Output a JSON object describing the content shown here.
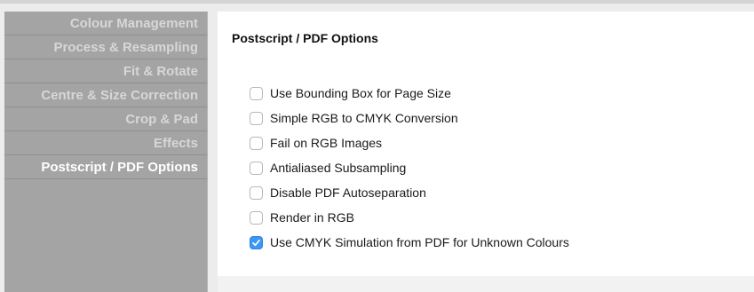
{
  "sidebar": {
    "items": [
      {
        "label": "Colour Management",
        "active": false
      },
      {
        "label": "Process & Resampling",
        "active": false
      },
      {
        "label": "Fit & Rotate",
        "active": false
      },
      {
        "label": "Centre & Size Correction",
        "active": false
      },
      {
        "label": "Crop & Pad",
        "active": false
      },
      {
        "label": "Effects",
        "active": false
      },
      {
        "label": "Postscript / PDF Options",
        "active": true
      }
    ]
  },
  "panel": {
    "title": "Postscript / PDF Options",
    "options": [
      {
        "label": "Use Bounding Box for Page Size",
        "checked": false
      },
      {
        "label": "Simple RGB to CMYK Conversion",
        "checked": false
      },
      {
        "label": "Fail on RGB Images",
        "checked": false
      },
      {
        "label": "Antialiased Subsampling",
        "checked": false
      },
      {
        "label": "Disable PDF Autoseparation",
        "checked": false
      },
      {
        "label": "Render in RGB",
        "checked": false
      },
      {
        "label": "Use CMYK Simulation from PDF for Unknown Colours",
        "checked": true
      }
    ]
  },
  "colors": {
    "accent": "#3c97f7",
    "sidebar_bg": "#a4a4a4",
    "sidebar_text": "#d7d7d7",
    "sidebar_active_text": "#ffffff"
  },
  "icons": {
    "checkmark": "checkmark-icon"
  }
}
